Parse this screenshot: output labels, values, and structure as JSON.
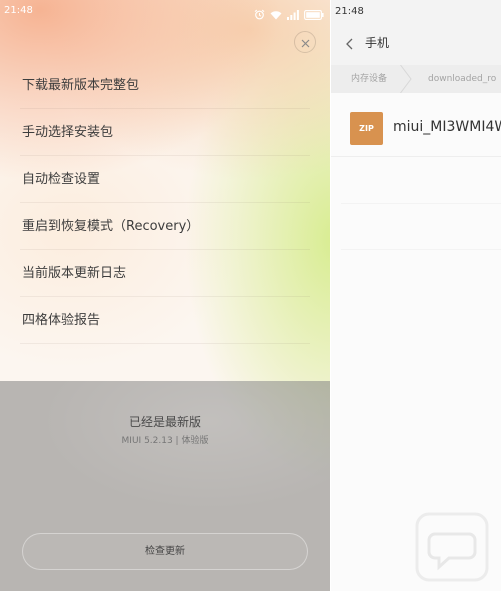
{
  "left_screen": {
    "status_bar": {
      "time": "21:48",
      "icons": [
        "alarm-icon",
        "wifi-icon",
        "signal-icon",
        "battery-icon"
      ]
    },
    "close_icon": "close-icon",
    "menu": {
      "items": [
        {
          "label": "下载最新版本完整包"
        },
        {
          "label": "手动选择安装包"
        },
        {
          "label": "自动检查设置"
        },
        {
          "label": "重启到恢复模式（Recovery）"
        },
        {
          "label": "当前版本更新日志"
        },
        {
          "label": "四格体验报告"
        }
      ]
    },
    "update_status": {
      "title": "已经是最新版",
      "version": "MIUI 5.2.13 | 体验版"
    },
    "check_update_button": {
      "label": "检查更新"
    }
  },
  "right_screen": {
    "status_bar": {
      "time": "21:48"
    },
    "header": {
      "back_icon": "back-icon",
      "title": "手机"
    },
    "breadcrumb": [
      {
        "label": "内存设备"
      },
      {
        "label": "downloaded_ro"
      }
    ],
    "files": [
      {
        "icon": "zip-file-icon",
        "type": "ZIP",
        "name": "miui_MI3WMI4W"
      }
    ]
  },
  "colors": {
    "zip_icon": "#d8924f",
    "menu_text": "#3d3d3d",
    "dim_overlay": "#8a8a8a"
  }
}
